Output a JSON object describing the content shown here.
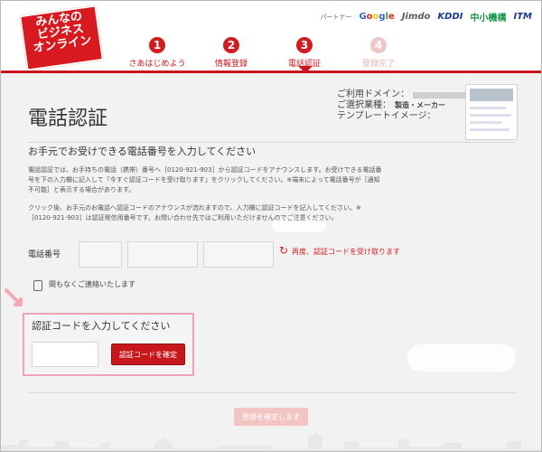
{
  "header": {
    "logo_text": [
      "みんなの",
      "ビジネス",
      "オンライン"
    ],
    "partners_label": "パートナー",
    "partners": [
      "Google",
      "Jimdo",
      "KDDI",
      "中小機構",
      "ITM"
    ]
  },
  "steps": [
    {
      "num": "1",
      "label": "さあはじめよう",
      "state": "done"
    },
    {
      "num": "2",
      "label": "情報登録",
      "state": "done"
    },
    {
      "num": "3",
      "label": "電話認証",
      "state": "current"
    },
    {
      "num": "4",
      "label": "登録完了",
      "state": "future"
    }
  ],
  "main": {
    "page_title": "電話認証",
    "domain_info": {
      "domain_label": "ご利用ドメイン：",
      "industry_label": "ご選択業種：",
      "industry_value": "製造・メーカー",
      "template_label": "テンプレートイメージ："
    },
    "subhead": "お手元でお受けできる電話番号を入力してください",
    "para1_line1": "電話認証では、お手持ちの電話（携帯）番号へ［0120-921-903］から認証コードをアナウンスします。お受けできる電話番",
    "para1_line2": "号を下の入力欄に記入して「今すぐ認証コードを受け取ります」をクリックしてください。※端末によって電話番号が［通知",
    "para1_line3": "不可能］と表示する場合があります。",
    "para2_line1": "クリック後、お手元のお電話へ認証コードのアナウンスが流れますので、入力欄に認証コードを記入してください。※",
    "para2_line2": "［0120-921-903］は認証発信用番号です。お問い合わせ先ではご利用いただけませんのでご注意ください。",
    "phone_label": "電話番号",
    "redo_text": "再度、認証コードを受け取ります",
    "status_text": "間もなくご連絡いたします",
    "verify_title": "認証コードを入力してください",
    "confirm_button": "認証コードを確定",
    "finalize_button": "登録を確定します"
  },
  "colors": {
    "brand_red": "#c8161d",
    "highlight_pink": "#f2a2b4",
    "disabled_pink": "#f3c4c4"
  }
}
